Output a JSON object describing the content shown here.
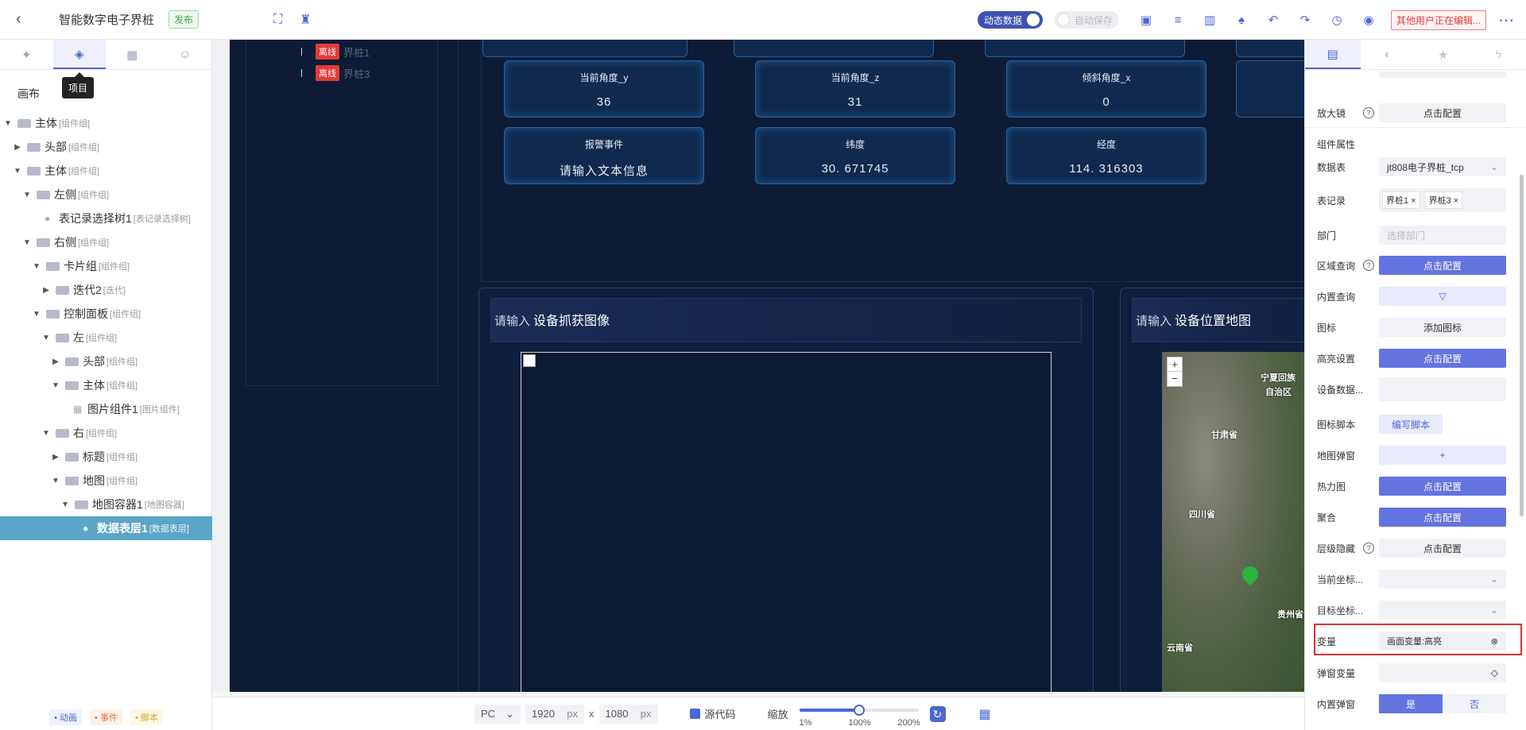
{
  "topbar": {
    "title": "智能数字电子界桩",
    "publish": "发布",
    "dynamic_data": "动态数据",
    "auto_save": "自动保存",
    "editing_warning": "其他用户正在编辑..."
  },
  "left": {
    "tooltip": "项目",
    "canvas": "画布",
    "tree": [
      {
        "label": "主体",
        "tag": "[组件组]",
        "depth": 0,
        "arrow": "▼"
      },
      {
        "label": "头部",
        "tag": "[组件组]",
        "depth": 1,
        "arrow": "▶"
      },
      {
        "label": "主体",
        "tag": "[组件组]",
        "depth": 1,
        "arrow": "▼"
      },
      {
        "label": "左侧",
        "tag": "[组件组]",
        "depth": 2,
        "arrow": "▼"
      },
      {
        "label": "表记录选择树1",
        "tag": "[表记录选择树]",
        "depth": 3,
        "arrow": ""
      },
      {
        "label": "右侧",
        "tag": "[组件组]",
        "depth": 2,
        "arrow": "▼"
      },
      {
        "label": "卡片组",
        "tag": "[组件组]",
        "depth": 3,
        "arrow": "▼"
      },
      {
        "label": "迭代2",
        "tag": "[迭代]",
        "depth": 4,
        "arrow": "▶"
      },
      {
        "label": "控制面板",
        "tag": "[组件组]",
        "depth": 3,
        "arrow": "▼"
      },
      {
        "label": "左",
        "tag": "[组件组]",
        "depth": 4,
        "arrow": "▼"
      },
      {
        "label": "头部",
        "tag": "[组件组]",
        "depth": 5,
        "arrow": "▶"
      },
      {
        "label": "主体",
        "tag": "[组件组]",
        "depth": 5,
        "arrow": "▼"
      },
      {
        "label": "图片组件1",
        "tag": "[图片组件]",
        "depth": 6,
        "arrow": ""
      },
      {
        "label": "右",
        "tag": "[组件组]",
        "depth": 4,
        "arrow": "▼"
      },
      {
        "label": "标题",
        "tag": "[组件组]",
        "depth": 5,
        "arrow": "▶"
      },
      {
        "label": "地图",
        "tag": "[组件组]",
        "depth": 5,
        "arrow": "▼"
      },
      {
        "label": "地图容器1",
        "tag": "[地图容器]",
        "depth": 6,
        "arrow": "▼"
      },
      {
        "label": "数据表层1",
        "tag": "[数据表层]",
        "depth": 7,
        "arrow": "",
        "selected": true
      }
    ],
    "footer": {
      "animation": "• 动画",
      "event": "• 事件",
      "script": "• 脚本"
    }
  },
  "stage": {
    "offline_items": [
      {
        "status": "离线",
        "name": "界桩1"
      },
      {
        "status": "离线",
        "name": "界桩3"
      }
    ],
    "cards": [
      {
        "title": "当前角度_y",
        "value": "36"
      },
      {
        "title": "当前角度_z",
        "value": "31"
      },
      {
        "title": "倾斜角度_x",
        "value": "0"
      },
      {
        "title": "报警事件",
        "value": "请输入文本信息"
      },
      {
        "title": "纬度",
        "value": "30. 671745"
      },
      {
        "title": "经度",
        "value": "114. 316303"
      }
    ],
    "panel_left": {
      "placeholder": "请输入",
      "title": "设备抓获图像"
    },
    "panel_right": {
      "placeholder": "请输入",
      "title": "设备位置地图"
    },
    "map_labels": [
      "宁夏回族",
      "自治区",
      "甘肃省",
      "四川省",
      "贵州省",
      "云南省"
    ]
  },
  "bottom": {
    "device": "PC",
    "width": "1920",
    "height": "1080",
    "unit": "px",
    "x": "x",
    "source": "源代码",
    "zoom_label": "缩放",
    "zoom_value": 0.5,
    "zoom_ticks": [
      "1%",
      "100%",
      "200%"
    ]
  },
  "right": {
    "magnifier": "放大镜",
    "click_config": "点击配置",
    "section": "组件属性",
    "datasheet_label": "数据表",
    "datasheet_value": "jt808电子界桩_tcp",
    "record_label": "表记录",
    "records": [
      "界桩1",
      "界桩3"
    ],
    "dept_label": "部门",
    "dept_placeholder": "选择部门",
    "area_query": "区域查询",
    "builtin_query": "内置查询",
    "icon_label": "图标",
    "add_icon": "添加图标",
    "highlight": "高亮设置",
    "device_data": "设备数据...",
    "icon_script": "图标脚本",
    "write_script": "编写脚本",
    "map_popup": "地图弹窗",
    "heatmap": "热力图",
    "cluster": "聚合",
    "layer_hide": "层级隐藏",
    "cur_coord": "当前坐标...",
    "target_coord": "目标坐标...",
    "variable": "变量",
    "variable_value": "画面变量:高亮",
    "popup_variable": "弹窗变量",
    "builtin_popup": "内置弹窗",
    "yes": "是",
    "no": "否"
  }
}
